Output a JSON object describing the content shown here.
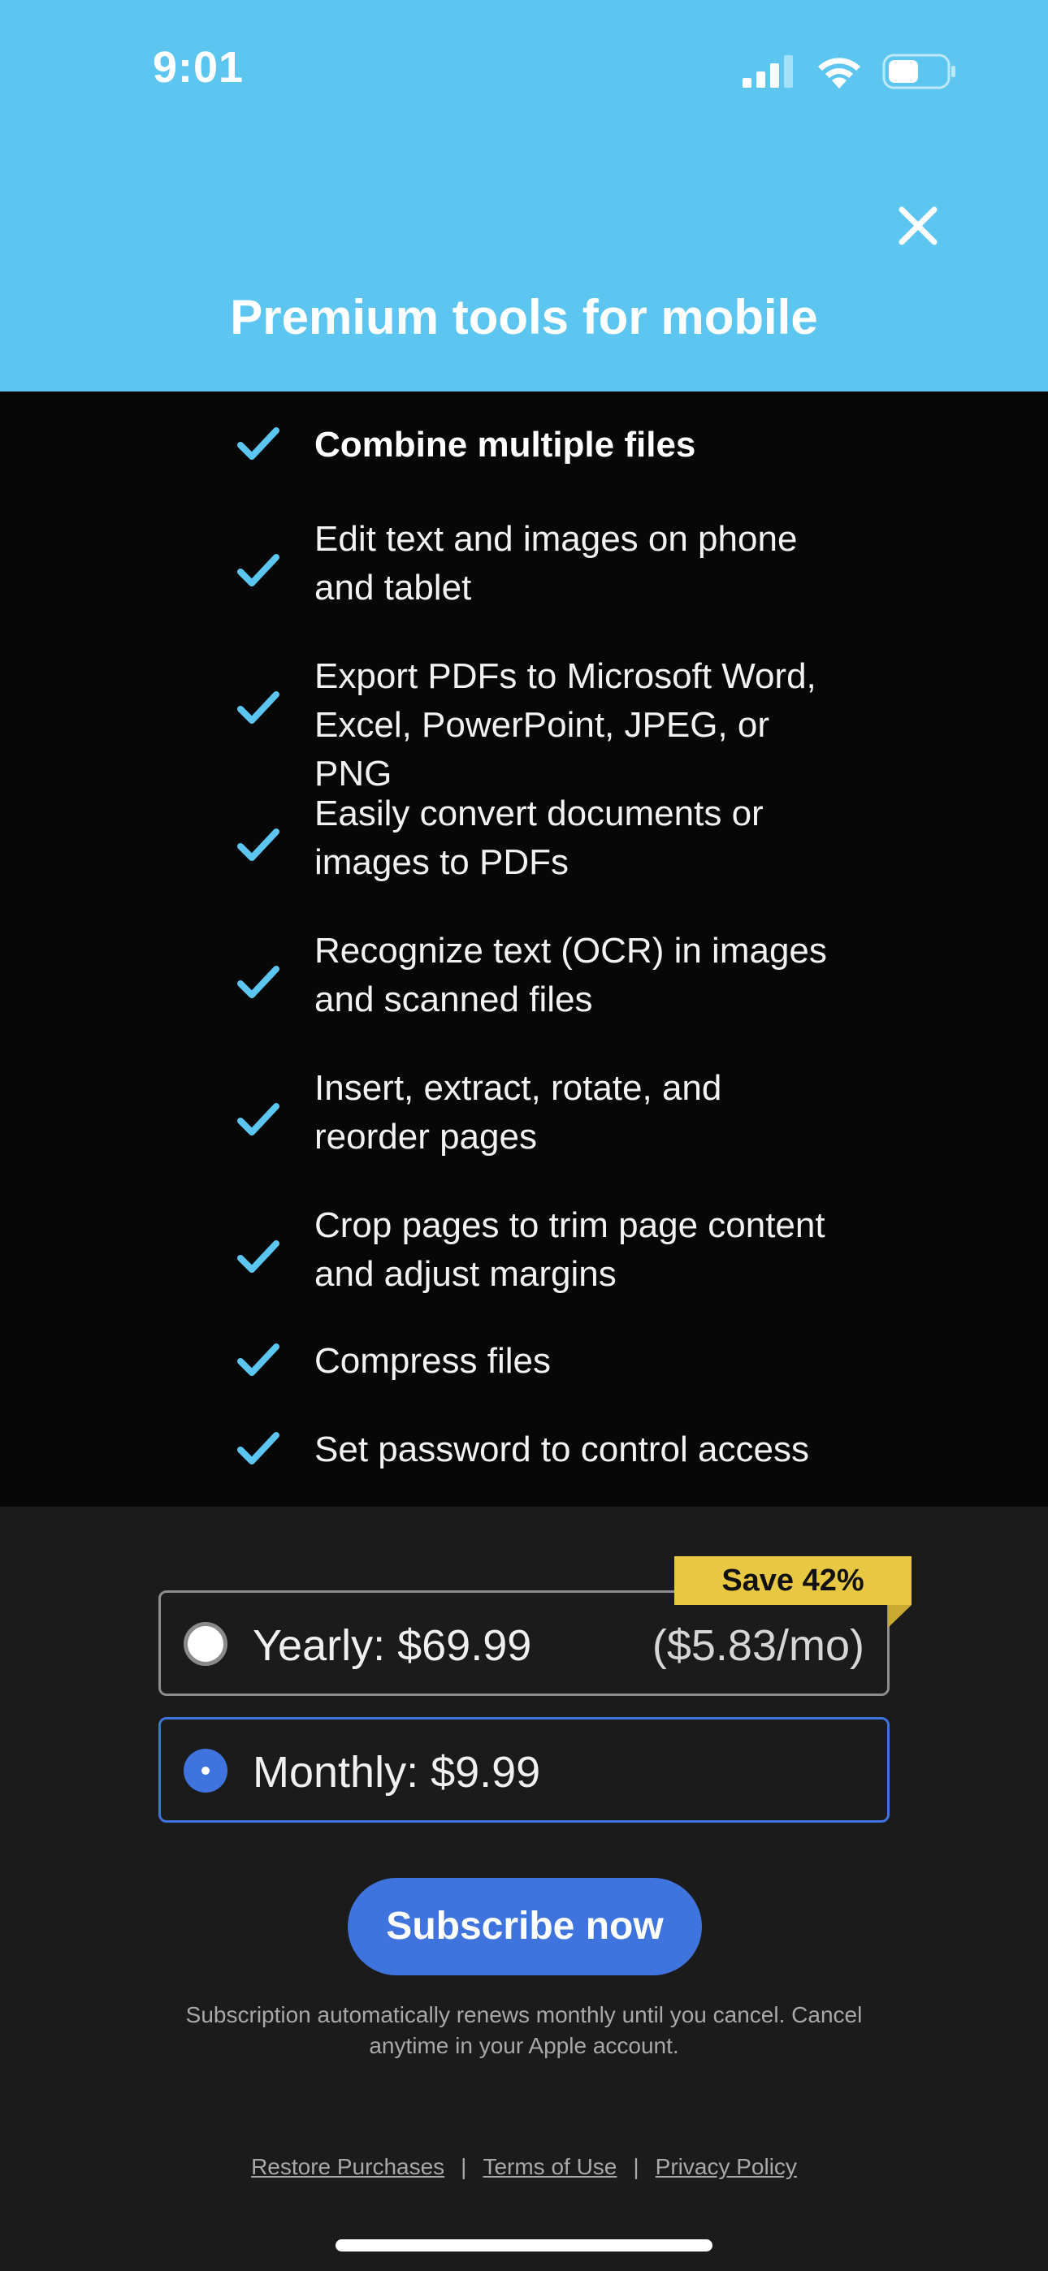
{
  "status_bar": {
    "time": "9:01",
    "icons": [
      "cellular-signal-icon",
      "wifi-icon",
      "battery-icon"
    ]
  },
  "header": {
    "title": "Premium tools for mobile",
    "close_icon": "close-icon",
    "background_color": "#5cc6f1"
  },
  "features": [
    {
      "text": "Combine multiple files"
    },
    {
      "text": "Edit text and images on phone and tablet"
    },
    {
      "text": "Export PDFs to Microsoft Word, Excel, PowerPoint, JPEG, or PNG"
    },
    {
      "text": "Easily convert documents or images to PDFs"
    },
    {
      "text": "Recognize text (OCR) in images and scanned files"
    },
    {
      "text": "Insert, extract, rotate, and reorder pages"
    },
    {
      "text": "Crop pages to trim page content and adjust margins"
    },
    {
      "text": "Compress files"
    },
    {
      "text": "Set password to control access"
    }
  ],
  "plans": {
    "save_badge": "Save 42%",
    "yearly": {
      "label": "Yearly: $69.99",
      "per_month": "($5.83/mo)",
      "selected": false
    },
    "monthly": {
      "label": "Monthly: $9.99",
      "selected": true
    }
  },
  "subscribe": {
    "button_label": "Subscribe now",
    "disclaimer": "Subscription automatically renews monthly until you cancel. Cancel anytime in your Apple account."
  },
  "footer": {
    "links": [
      "Restore Purchases",
      "Terms of Use",
      "Privacy Policy"
    ],
    "separator": "|"
  },
  "colors": {
    "accent_blue": "#3f74de",
    "check_blue": "#5cc6f1",
    "badge_yellow": "#e8c842"
  }
}
